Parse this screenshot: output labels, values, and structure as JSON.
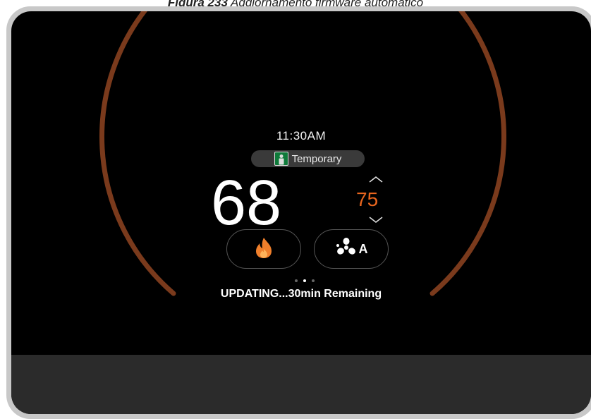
{
  "caption": {
    "figure_label": "Figura 233",
    "text": " Aggiornamento firmware automatico"
  },
  "thermostat": {
    "time": "11:30AM",
    "mode_label": "Temporary",
    "current_temp": "68",
    "setpoint": "75",
    "heat_icon": "flame-icon",
    "fan_icon": "fan-icon",
    "fan_mode_letter": "A",
    "page_indicator": {
      "count": 3,
      "active_index": 1
    },
    "status_text": "UPDATING...30min Remaining"
  },
  "colors": {
    "arc": "#7a3a1c",
    "setpoint": "#e8651e",
    "flame": "#f07f2b",
    "person_icon": "#0f7a3a"
  }
}
